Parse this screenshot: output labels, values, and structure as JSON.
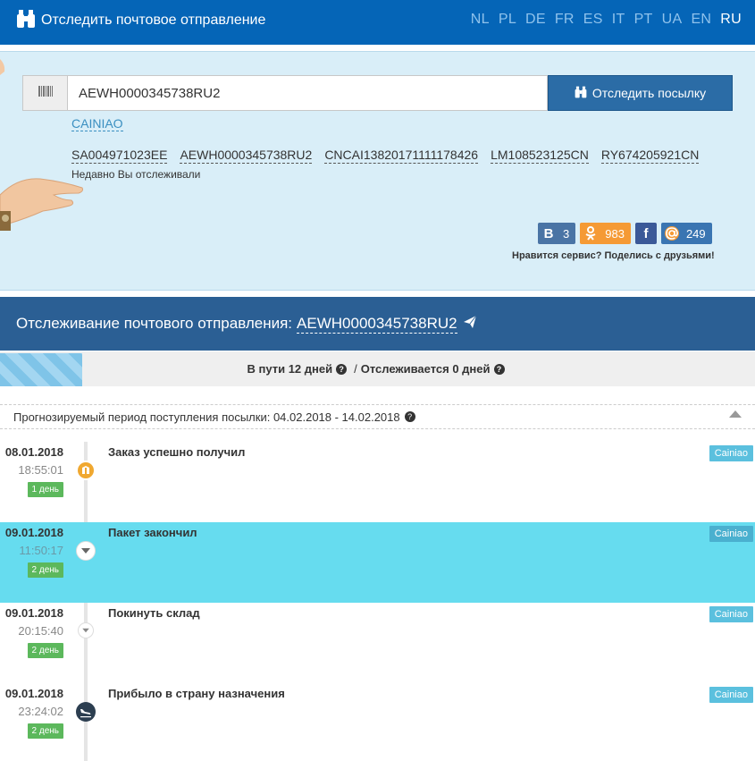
{
  "header": {
    "brand_title": "Отследить почтовое отправление",
    "languages": [
      "NL",
      "PL",
      "DE",
      "FR",
      "ES",
      "IT",
      "PT",
      "UA",
      "EN",
      "RU"
    ],
    "active_language": "RU"
  },
  "search": {
    "value": "AEWH0000345738RU2",
    "button_label": "Отследить посылку",
    "carrier_link": "CAINIAO",
    "recent": [
      "SA004971023EE",
      "AEWH0000345738RU2",
      "CNCAI13820171111178426",
      "LM108523125CN",
      "RY674205921CN"
    ],
    "recent_label": "Недавно Вы отслеживали"
  },
  "social": {
    "vk_count": "3",
    "ok_count": "983",
    "mail_count": "249",
    "share_text": "Нравится сервис? Поделись с друзьями!"
  },
  "tracking": {
    "title_prefix": "Отслеживание почтового отправления:",
    "number": "AEWH0000345738RU2",
    "in_transit": "В пути 12 дней",
    "separator": "/",
    "tracked": "Отслеживается 0 дней",
    "transit_progress": 0.11,
    "forecast": "Прогнозируемый период поступления посылки: 04.02.2018 - 14.02.2018"
  },
  "events": [
    {
      "date": "08.01.2018",
      "time": "18:55:01",
      "days": "1 день",
      "title": "Заказ успешно получил",
      "source": "Cainiao",
      "icon": "package-icon",
      "highlight": false
    },
    {
      "date": "09.01.2018",
      "time": "11:50:17",
      "days": "2 день",
      "title": "Пакет закончил",
      "source": "Cainiao",
      "icon": "chevron-down-icon",
      "highlight": true
    },
    {
      "date": "09.01.2018",
      "time": "20:15:40",
      "days": "2 день",
      "title": "Покинуть склад",
      "source": "Cainiao",
      "icon": "chevron-down-icon",
      "highlight": false
    },
    {
      "date": "09.01.2018",
      "time": "23:24:02",
      "days": "2 день",
      "title": "Прибыло в страну назначения",
      "source": "Cainiao",
      "icon": "airplane-landing-icon",
      "highlight": false
    }
  ],
  "colors": {
    "header_bg": "#0565b7",
    "panel_bg": "#d9eef8",
    "tracking_header_bg": "#2b5f94",
    "highlight_row": "#66dcef",
    "days_badge": "#5cb85c",
    "source_badge": "#5bc0de"
  }
}
